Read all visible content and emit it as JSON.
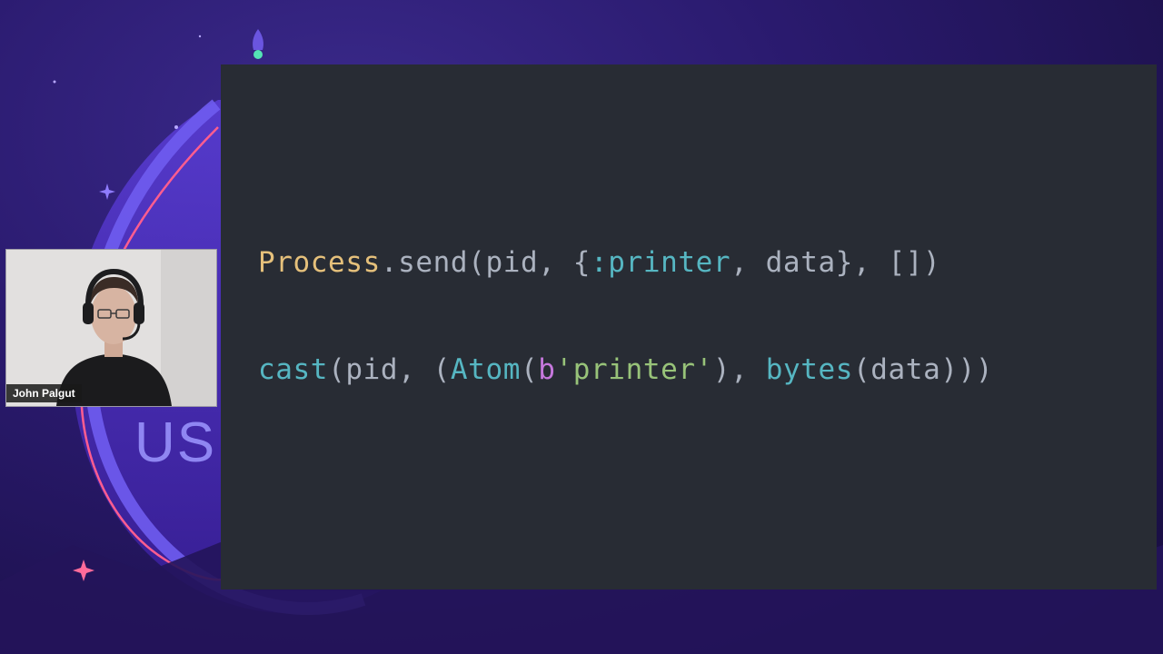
{
  "presentation": {
    "background_text": "US",
    "code_lines": [
      [
        {
          "text": "Process",
          "kind": "module"
        },
        {
          "text": ".send(pid, {",
          "kind": "ident"
        },
        {
          "text": ":printer",
          "kind": "atom"
        },
        {
          "text": ", data}, [])",
          "kind": "ident"
        }
      ],
      [
        {
          "text": "cast",
          "kind": "builtin"
        },
        {
          "text": "(pid, (",
          "kind": "ident"
        },
        {
          "text": "Atom",
          "kind": "class"
        },
        {
          "text": "(",
          "kind": "ident"
        },
        {
          "text": "b",
          "kind": "prefix"
        },
        {
          "text": "'printer'",
          "kind": "string"
        },
        {
          "text": "), ",
          "kind": "ident"
        },
        {
          "text": "bytes",
          "kind": "builtin"
        },
        {
          "text": "(data)))",
          "kind": "ident"
        }
      ]
    ]
  },
  "webcam": {
    "speaker_name": "John Palgut"
  },
  "colors": {
    "slide_background": "#282c34",
    "module": "#e5c07b",
    "atom": "#56b6c2",
    "string": "#98c379",
    "prefix": "#c678dd",
    "text": "#abb2bf"
  }
}
